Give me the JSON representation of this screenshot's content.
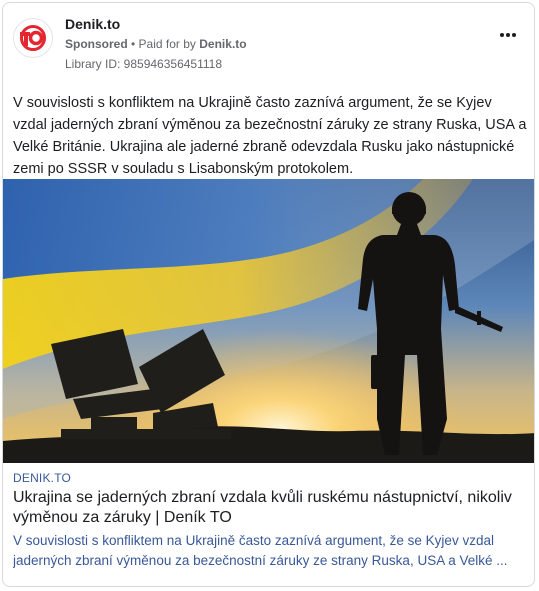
{
  "ad": {
    "page_name": "Denik.to",
    "sponsored": "Sponsored",
    "paid_prefix": "• Paid for by",
    "paid_by": "Denik.to",
    "library_id": "Library ID: 985946356451118",
    "logo_text": "TO",
    "more_icon": "more-horizontal-icon"
  },
  "post": {
    "text": "V souvislosti s konfliktem na Ukrajině často zaznívá argument, že se Kyjev vzdal jaderných zbraní výměnou za bezečnostní záruky ze strany Ruska, USA a Velké Británie. Ukrajina ale jaderné zbraně odevzdala Rusku jako nástupnické zemi po SSSR v souladu s Lisabonským protokolem."
  },
  "link": {
    "domain": "DENIK.TO",
    "headline": "Ukrajina se jaderných zbraní vzdala kvůli ruskému nástupnictví, nikoliv výměnou za záruky | Deník TO",
    "description_line1": "V souvislosti s konfliktem na Ukrajině často zaznívá argument, že se Kyjev vzdal",
    "description_line2": "jaderných zbraní výměnou za bezečnostní záruky ze strany Ruska, USA a Velké ..."
  },
  "colors": {
    "brand_red": "#e3262f",
    "link_blue": "#385898",
    "flag_blue": "#3b6db3",
    "flag_yellow": "#f3d21a"
  }
}
